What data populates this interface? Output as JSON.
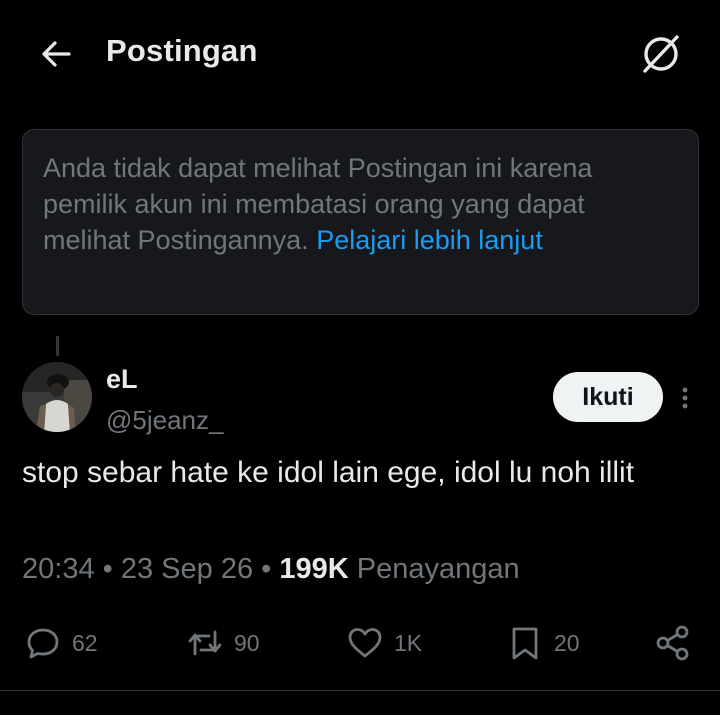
{
  "header": {
    "title": "Postingan",
    "back_icon": "arrow-left-icon",
    "grok_icon": "grok-icon"
  },
  "notice": {
    "text": "Anda tidak dapat melihat Postingan ini karena pemilik akun ini membatasi orang yang dapat melihat Postingannya.",
    "link_text": "Pelajari lebih lanjut"
  },
  "tweet": {
    "display_name": "eL",
    "handle": "@5jeanz_",
    "follow_label": "Ikuti",
    "text": "stop sebar hate ke  idol lain ege, idol lu noh illit",
    "time": "20:34",
    "date": "23 Sep 26",
    "separator": "•",
    "views_count": "199K",
    "views_label": "Penayangan"
  },
  "actions": {
    "replies": "62",
    "reposts": "90",
    "likes": "1K",
    "bookmarks": "20"
  },
  "colors": {
    "background": "#000000",
    "text": "#e7e9ea",
    "muted": "#71767b",
    "link": "#1d9bf0",
    "card": "#16181c"
  }
}
